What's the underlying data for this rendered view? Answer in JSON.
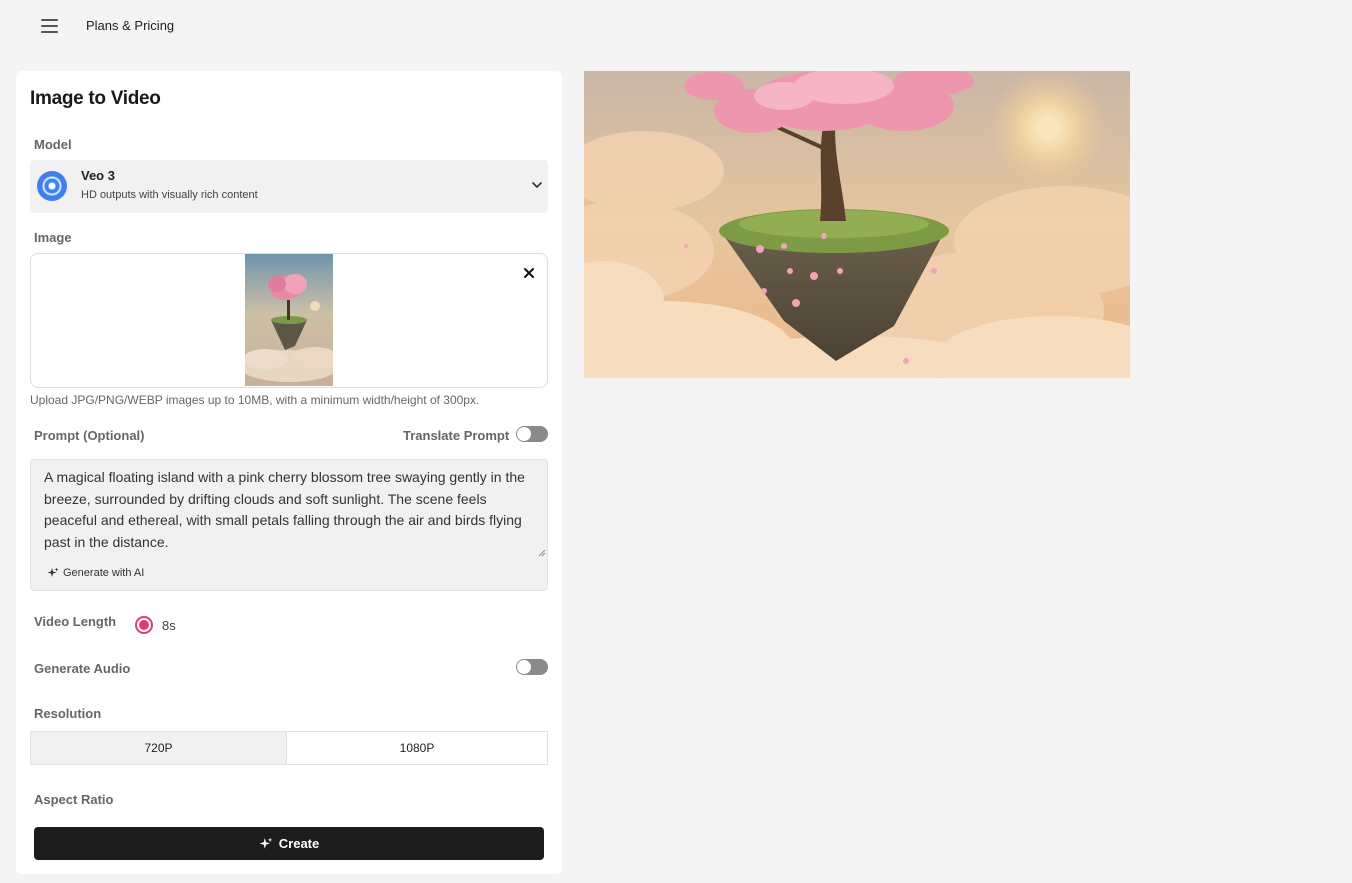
{
  "nav": {
    "plans_label": "Plans & Pricing"
  },
  "panel": {
    "title": "Image to Video",
    "model": {
      "label": "Model",
      "name": "Veo 3",
      "description": "HD outputs with visually rich content"
    },
    "image": {
      "label": "Image",
      "hint": "Upload JPG/PNG/WEBP images up to 10MB, with a minimum width/height of 300px."
    },
    "prompt": {
      "label": "Prompt (Optional)",
      "translate_label": "Translate Prompt",
      "translate_on": false,
      "text": "A magical floating island with a pink cherry blossom tree swaying gently in the breeze, surrounded by drifting clouds and soft sunlight. The scene feels peaceful and ethereal, with small petals falling through the air and birds flying past in the distance.",
      "generate_label": "Generate with AI"
    },
    "video_length": {
      "label": "Video Length",
      "option": "8s",
      "selected": true
    },
    "audio": {
      "label": "Generate Audio",
      "on": false
    },
    "resolution": {
      "label": "Resolution",
      "options": [
        "720P",
        "1080P"
      ],
      "selected": "720P"
    },
    "aspect_ratio": {
      "label": "Aspect Ratio"
    },
    "create_label": "Create"
  },
  "colors": {
    "accent": "#e03a7a",
    "button": "#1c1c1c",
    "model_logo": "#3b82f6"
  },
  "icons": [
    "menu-icon",
    "veo-logo-icon",
    "chevron-down-icon",
    "close-icon",
    "sparkle-icon"
  ]
}
